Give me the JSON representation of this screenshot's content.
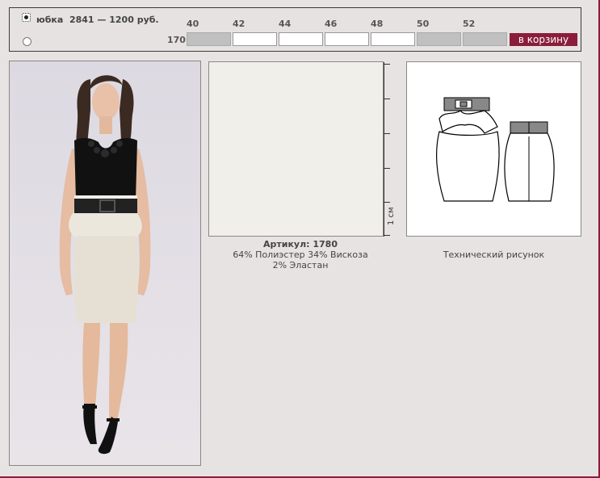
{
  "order": {
    "product_name": "юбка",
    "product_code": "2841",
    "separator": "—",
    "price": "1200 руб.",
    "height_label": "170",
    "sizes": [
      {
        "label": "40",
        "available": false
      },
      {
        "label": "42",
        "available": true
      },
      {
        "label": "44",
        "available": true
      },
      {
        "label": "46",
        "available": true
      },
      {
        "label": "48",
        "available": true
      },
      {
        "label": "50",
        "available": false
      },
      {
        "label": "52",
        "available": false
      }
    ],
    "cart_button": "в корзину"
  },
  "fabric": {
    "article_label": "Артикул: 1780",
    "composition_line1": "64% Полиэстер 34% Вискоза",
    "composition_line2": "2% Эластан",
    "ruler_label": "1 см"
  },
  "tech": {
    "caption": "Технический рисунок"
  },
  "colors": {
    "accent": "#8a1d3a",
    "background": "#e8e3e3",
    "unavailable": "#c0c0c0"
  }
}
